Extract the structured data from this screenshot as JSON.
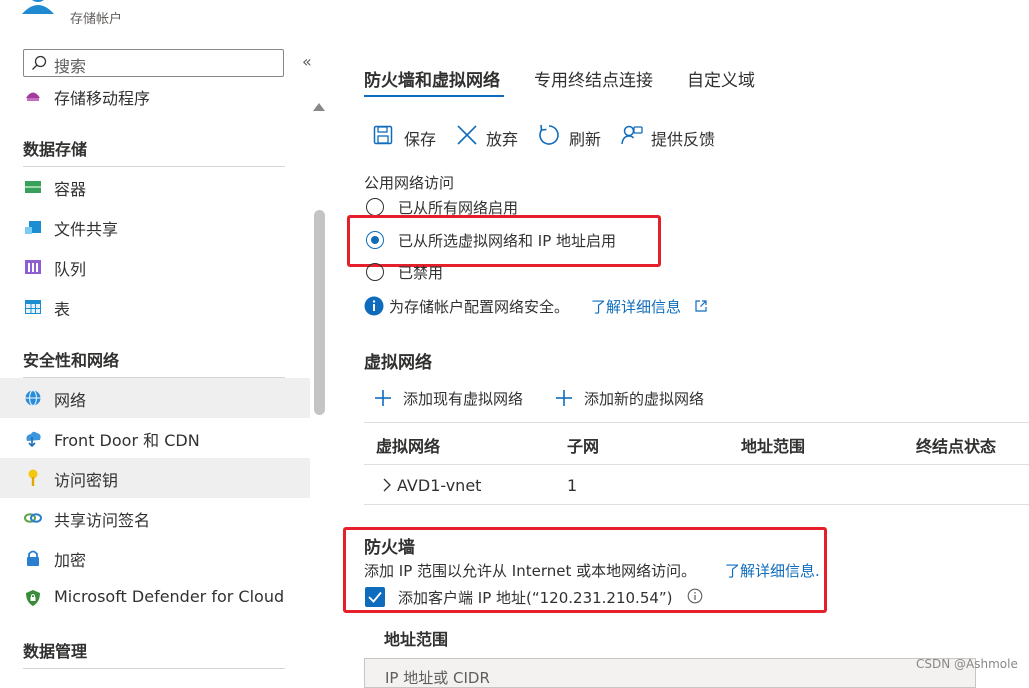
{
  "header": {
    "subtitle": "存储帐户"
  },
  "sidebar": {
    "search_placeholder": "搜索",
    "collapse_glyph": "«",
    "items_top": [
      {
        "label": "存储移动程序",
        "icon": "mover-icon"
      }
    ],
    "sections": [
      {
        "title": "数据存储",
        "items": [
          {
            "label": "容器",
            "icon": "container-icon"
          },
          {
            "label": "文件共享",
            "icon": "file-share-icon"
          },
          {
            "label": "队列",
            "icon": "queue-icon"
          },
          {
            "label": "表",
            "icon": "table-icon"
          }
        ]
      },
      {
        "title": "安全性和网络",
        "items": [
          {
            "label": "网络",
            "icon": "network-icon",
            "selected": true
          },
          {
            "label": "Front Door 和 CDN",
            "icon": "cdn-icon"
          },
          {
            "label": "访问密钥",
            "icon": "key-icon",
            "hover": true
          },
          {
            "label": "共享访问签名",
            "icon": "link-icon"
          },
          {
            "label": "加密",
            "icon": "lock-icon"
          },
          {
            "label": "Microsoft Defender for Cloud",
            "icon": "shield-icon"
          }
        ]
      },
      {
        "title": "数据管理",
        "items": []
      }
    ]
  },
  "tabs": [
    {
      "label": "防火墙和虚拟网络",
      "active": true
    },
    {
      "label": "专用终结点连接"
    },
    {
      "label": "自定义域"
    }
  ],
  "toolbar": {
    "save": "保存",
    "discard": "放弃",
    "refresh": "刷新",
    "feedback": "提供反馈"
  },
  "public_access": {
    "label": "公用网络访问",
    "options": [
      {
        "label": "已从所有网络启用",
        "checked": false
      },
      {
        "label": "已从所选虚拟网络和 IP 地址启用",
        "checked": true
      },
      {
        "label": "已禁用",
        "checked": false
      }
    ],
    "info": "为存储帐户配置网络安全。",
    "learn_more": "了解详细信息"
  },
  "vnet": {
    "title": "虚拟网络",
    "add_existing": "添加现有虚拟网络",
    "add_new": "添加新的虚拟网络",
    "columns": [
      "虚拟网络",
      "子网",
      "地址范围",
      "终结点状态"
    ],
    "rows": [
      {
        "name": "AVD1-vnet",
        "subnet": "1"
      }
    ]
  },
  "firewall": {
    "title": "防火墙",
    "desc": "添加 IP 范围以允许从 Internet 或本地网络访问。",
    "learn_more": "了解详细信息.",
    "add_client_ip": "添加客户端 IP 地址(“120.231.210.54”)",
    "add_client_checked": true,
    "range_label": "地址范围",
    "range_placeholder": "IP 地址或 CIDR"
  },
  "watermark": "CSDN @Ashmole",
  "colors": {
    "accent": "#0f6cbd",
    "highlight": "#e5202b",
    "selected_bg": "#efefef"
  }
}
